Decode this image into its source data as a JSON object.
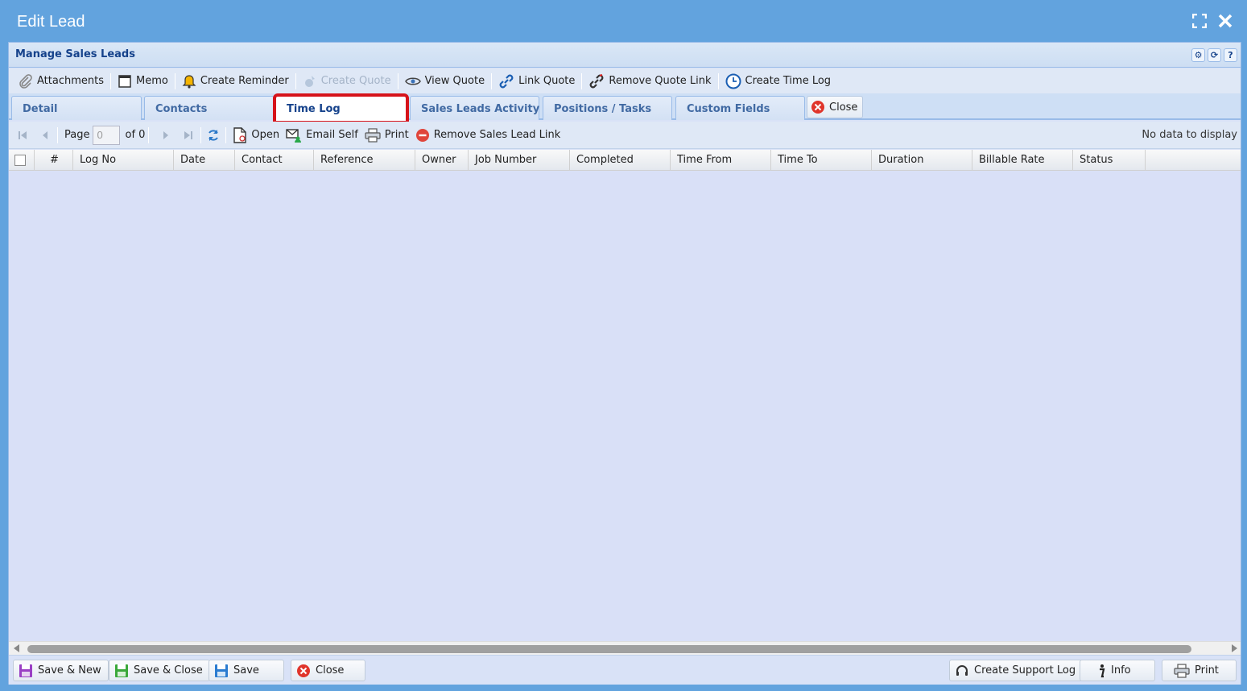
{
  "window": {
    "title": "Edit Lead"
  },
  "panel": {
    "title": "Manage Sales Leads"
  },
  "toolbar": {
    "attachments": "Attachments",
    "memo": "Memo",
    "create_reminder": "Create Reminder",
    "create_quote": "Create Quote",
    "view_quote": "View Quote",
    "link_quote": "Link Quote",
    "remove_quote_link": "Remove Quote Link",
    "create_time_log": "Create Time Log"
  },
  "tabs": {
    "detail": "Detail",
    "contacts": "Contacts",
    "time_log": "Time Log",
    "sales_leads_activity": "Sales Leads Activity",
    "positions_tasks": "Positions / Tasks",
    "custom_fields": "Custom Fields",
    "close": "Close",
    "active": "Time Log"
  },
  "paging": {
    "page_label": "Page",
    "page_value": "0",
    "of_label": "of 0",
    "open": "Open",
    "email_self": "Email Self",
    "print": "Print",
    "remove_link": "Remove Sales Lead Link",
    "status": "No data to display"
  },
  "grid": {
    "columns": [
      "#",
      "Log No",
      "Date",
      "Contact",
      "Reference",
      "Owner",
      "Job Number",
      "Completed",
      "Time From",
      "Time To",
      "Duration",
      "Billable Rate",
      "Status"
    ],
    "rows": []
  },
  "footer": {
    "save_new": "Save & New",
    "save_close": "Save & Close",
    "save": "Save",
    "close": "Close",
    "create_support_log": "Create Support Log",
    "info": "Info",
    "print": "Print"
  },
  "colors": {
    "window_bg": "#62a3de",
    "tab_highlight": "#d6131a",
    "header_text": "#15428b"
  }
}
